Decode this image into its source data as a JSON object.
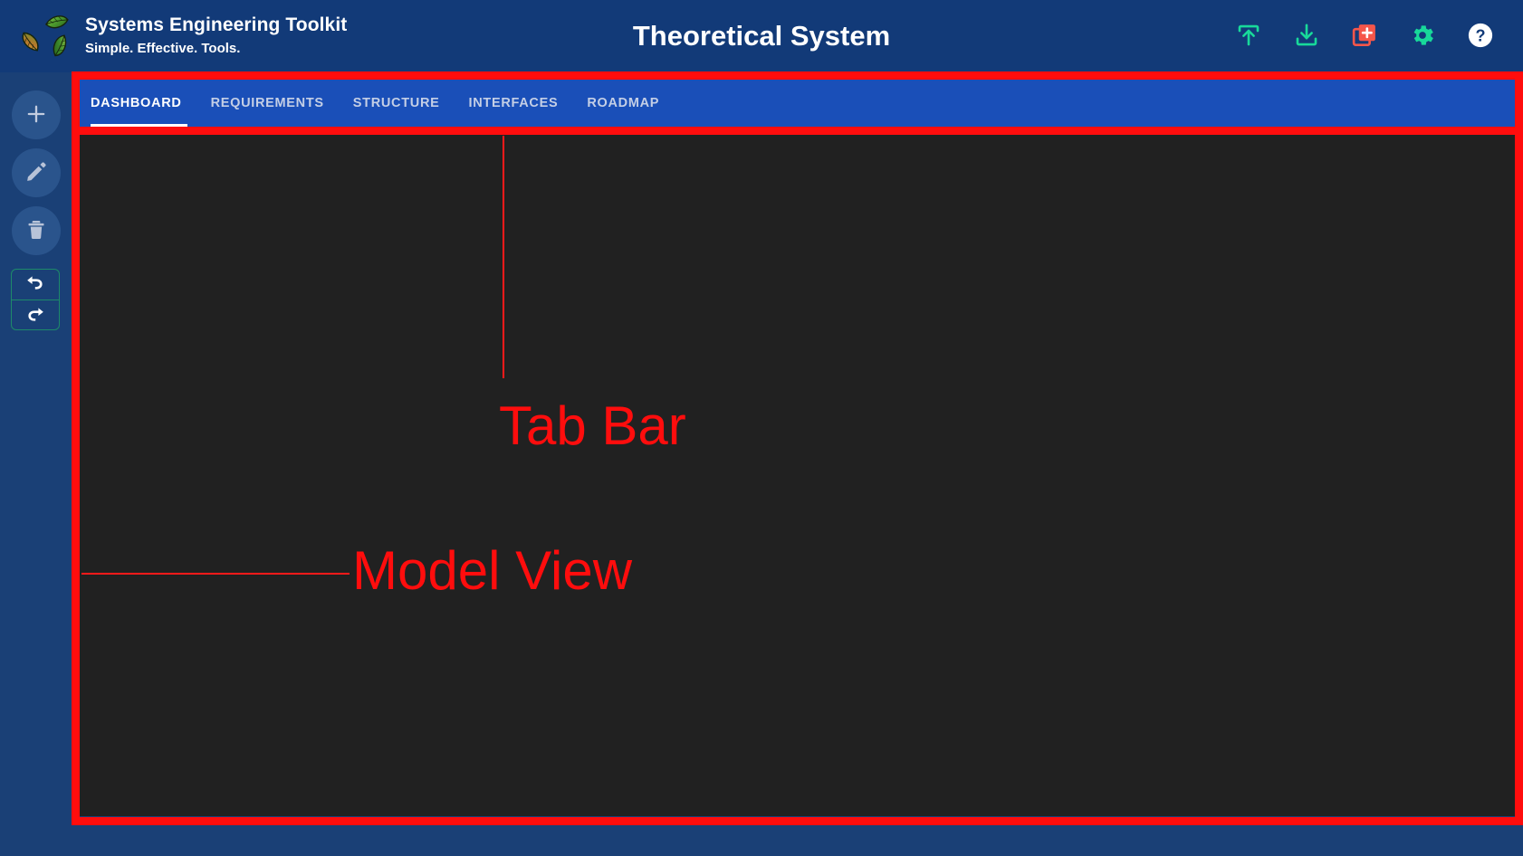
{
  "header": {
    "logo_icon": "three-leaves-recycle-logo",
    "app_title": "Systems Engineering Toolkit",
    "tagline": "Simple. Effective. Tools.",
    "project_title": "Theoretical System",
    "actions": [
      {
        "name": "upload-icon",
        "label": "Upload",
        "color": "#18d99a"
      },
      {
        "name": "download-icon",
        "label": "Download",
        "color": "#18d99a"
      },
      {
        "name": "new-file-icon",
        "label": "New Document",
        "color": "#f5564a"
      },
      {
        "name": "gear-icon",
        "label": "Settings",
        "color": "#18d99a"
      },
      {
        "name": "help-icon",
        "label": "Help",
        "color": "#ffffff"
      }
    ]
  },
  "sidebar": {
    "tools": [
      {
        "name": "add-icon",
        "label": "Add"
      },
      {
        "name": "edit-icon",
        "label": "Edit"
      },
      {
        "name": "delete-icon",
        "label": "Delete"
      }
    ],
    "history": [
      {
        "name": "undo-icon",
        "label": "Undo"
      },
      {
        "name": "redo-icon",
        "label": "Redo"
      }
    ]
  },
  "tabs": [
    {
      "label": "DASHBOARD",
      "active": true
    },
    {
      "label": "REQUIREMENTS",
      "active": false
    },
    {
      "label": "STRUCTURE",
      "active": false
    },
    {
      "label": "INTERFACES",
      "active": false
    },
    {
      "label": "ROADMAP",
      "active": false
    }
  ],
  "annotations": {
    "tab_bar_label": "Tab Bar",
    "model_view_label": "Model View",
    "color": "#ff0d0d"
  },
  "colors": {
    "header_bg": "#123a78",
    "sidebar_bg": "#1a4076",
    "tabbar_bg": "#1a4fb8",
    "content_bg": "#212121",
    "accent_green": "#18d99a",
    "accent_red": "#f5564a",
    "annotation_red": "#ff0d0d"
  }
}
